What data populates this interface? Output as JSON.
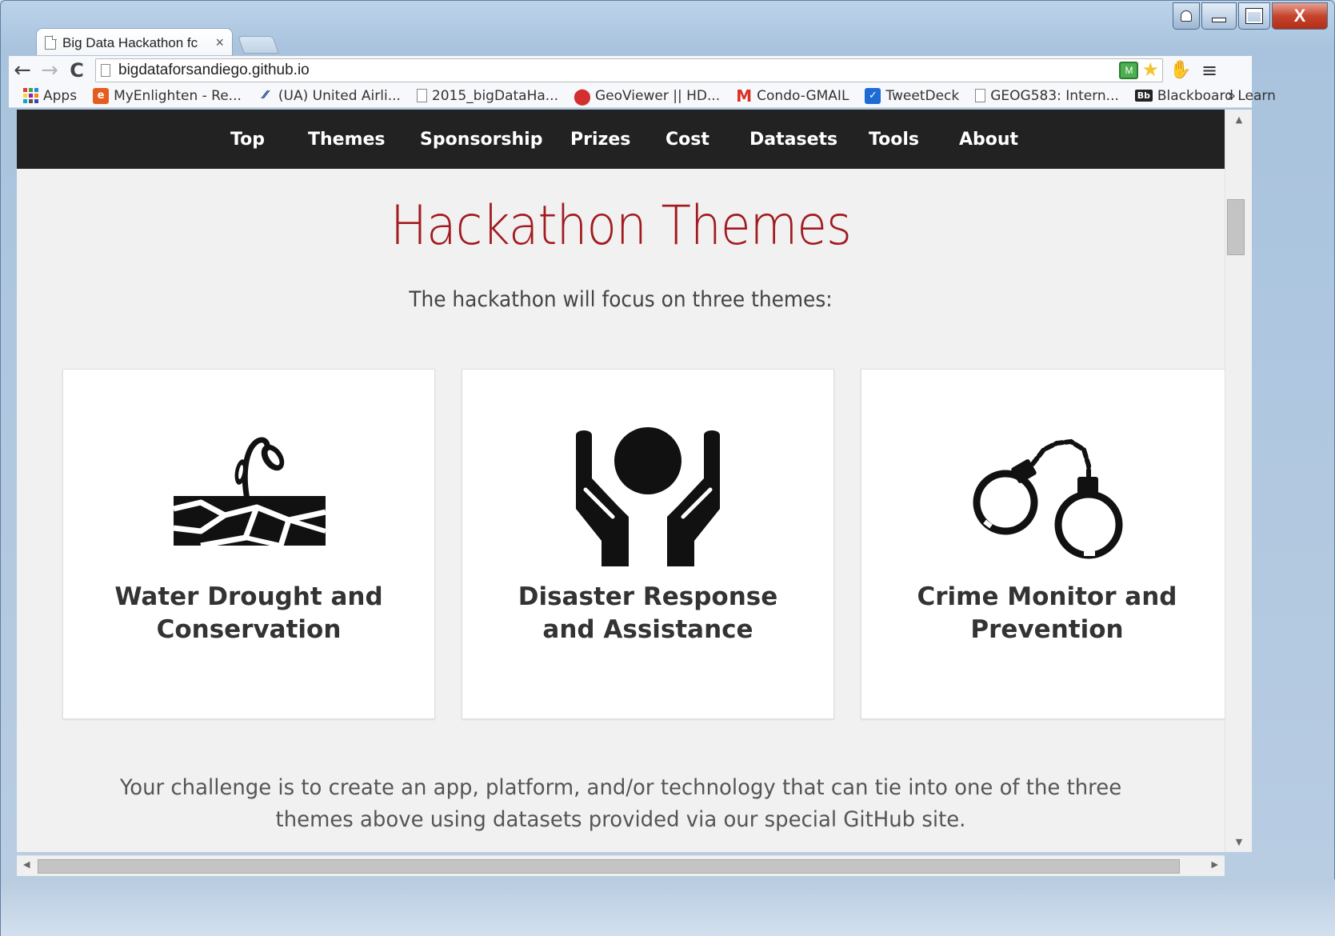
{
  "browser": {
    "tab_title": "Big Data Hackathon fc",
    "tab_close": "×",
    "url": "bigdataforsandiego.github.io",
    "nav_back": "←",
    "nav_forward": "→",
    "nav_reload": "C",
    "window_close": "X",
    "menu": "≡",
    "extension_label": "M"
  },
  "bookmarks": {
    "items": [
      {
        "label": "Apps",
        "icon": "apps-grid-icon"
      },
      {
        "label": "MyEnlighten - Re...",
        "icon": "enlighten-icon",
        "glyph": "e"
      },
      {
        "label": "(UA) United Airli...",
        "icon": "united-airlines-icon",
        "glyph": "⁄⁄"
      },
      {
        "label": "2015_bigDataHa...",
        "icon": "document-icon"
      },
      {
        "label": "GeoViewer || HD...",
        "icon": "map-pin-icon",
        "glyph": "⬤"
      },
      {
        "label": "Condo-GMAIL",
        "icon": "gmail-icon",
        "glyph": "M"
      },
      {
        "label": "TweetDeck",
        "icon": "tweetdeck-icon",
        "glyph": "✓"
      },
      {
        "label": "GEOG583: Intern...",
        "icon": "document-icon"
      },
      {
        "label": "Blackboard Learn",
        "icon": "blackboard-icon",
        "glyph": "Bb"
      }
    ],
    "more": "»"
  },
  "site_nav": {
    "links": [
      "Top",
      "Themes",
      "Sponsorship",
      "Prizes",
      "Cost",
      "Datasets",
      "Tools",
      "About"
    ]
  },
  "themes": {
    "title": "Hackathon Themes",
    "subtitle": "The hackathon will focus on three themes:",
    "cards": [
      {
        "title": "Water Drought and Conservation",
        "icon": "sprout-dry-soil-icon"
      },
      {
        "title": "Disaster Response and Assistance",
        "icon": "hands-holding-icon"
      },
      {
        "title": "Crime Monitor and Prevention",
        "icon": "handcuffs-icon"
      }
    ],
    "challenge": "Your challenge is to create an app, platform, and/or technology that can tie into one of the three themes above using datasets provided via our special GitHub site."
  },
  "colors": {
    "nav_bg": "#222222",
    "title_red": "#a21b1f",
    "page_bg": "#f1f1f1"
  }
}
